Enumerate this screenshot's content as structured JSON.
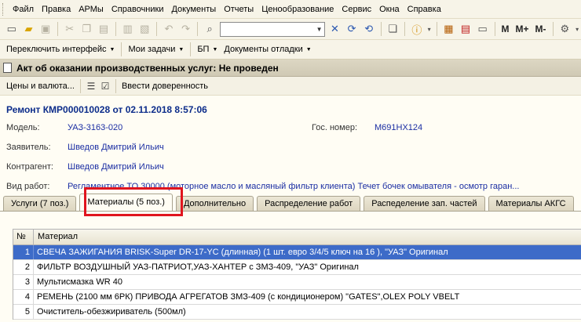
{
  "menu": [
    "Файл",
    "Правка",
    "АРМы",
    "Справочники",
    "Документы",
    "Отчеты",
    "Ценообразование",
    "Сервис",
    "Окна",
    "Справка"
  ],
  "toolbar": {
    "buttons": [
      "new-doc-icon",
      "open-folder-icon",
      "save-icon",
      "cut-icon",
      "copy-icon",
      "paste-icon",
      "print-icon",
      "print-preview-icon",
      "undo-icon",
      "redo-icon",
      "search-icon",
      "find-next-icon",
      "find-prev-icon",
      "windows-icon",
      "info-icon",
      "calculator-icon",
      "calendar-icon",
      "settings-icon"
    ],
    "search_value": "",
    "memory_buttons": [
      "M",
      "M+",
      "M-"
    ]
  },
  "panel": {
    "items": [
      "Переключить интерфейс",
      "Мои задачи",
      "БП",
      "Документы отладки"
    ]
  },
  "window": {
    "title": "Акт об оказании производственных услуг: Не проведен"
  },
  "actions": {
    "prices_button": "Цены и валюта...",
    "power_of_attorney_button": "Ввести доверенность"
  },
  "document": {
    "header": "Ремонт КМР000010028 от 02.11.2018 8:57:06",
    "model_label": "Модель:",
    "model_value": "УАЗ-3163-020",
    "plate_label": "Гос. номер:",
    "plate_value": "М691НХ124",
    "applicant_label": "Заявитель:",
    "applicant_value": "Шведов Дмитрий Ильич",
    "contractor_label": "Контрагент:",
    "contractor_value": "Шведов Дмитрий Ильич",
    "work_label": "Вид работ:",
    "work_value": "Регламентное ТО 30000 (моторное масло и масляный фильтр клиента) Течет бочек омывателя - осмотр гаран..."
  },
  "tabs": [
    {
      "label": "Услуги (7 поз.)",
      "active": false
    },
    {
      "label": "Материалы (5 поз.)",
      "active": true
    },
    {
      "label": "Дополнительно",
      "active": false
    },
    {
      "label": "Распределение работ",
      "active": false
    },
    {
      "label": "Распеделение зап. частей",
      "active": false
    },
    {
      "label": "Материалы АКГС",
      "active": false
    }
  ],
  "grid": {
    "headers": {
      "num": "№",
      "material": "Материал"
    },
    "rows": [
      {
        "num": "1",
        "material": "СВЕЧА ЗАЖИГАНИЯ BRISK-Super DR-17-YC  (длинная) (1 шт. евро 3/4/5 ключ на 16 ), \"УАЗ\" Оригинал",
        "selected": true
      },
      {
        "num": "2",
        "material": "ФИЛЬТР ВОЗДУШНЫЙ УАЗ-ПАТРИОТ,УАЗ-ХАНТЕР с ЗМЗ-409, \"УАЗ\" Оригинал",
        "selected": false
      },
      {
        "num": "3",
        "material": "Мультисмазка WR 40",
        "selected": false
      },
      {
        "num": "4",
        "material": "РЕМЕНЬ (2100 мм 6РК) ПРИВОДА АГРЕГАТОВ ЗМЗ-409 (с кондиционером) \"GATES\",OLEX POLY VBELT",
        "selected": false
      },
      {
        "num": "5",
        "material": "Очиститель-обезжириватель (500мл)",
        "selected": false
      }
    ]
  }
}
